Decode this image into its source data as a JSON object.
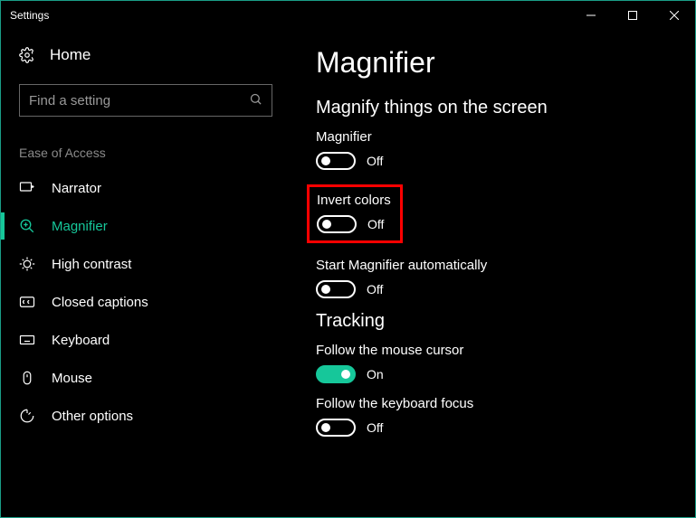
{
  "window": {
    "title": "Settings"
  },
  "sidebar": {
    "home": "Home",
    "search_placeholder": "Find a setting",
    "section": "Ease of Access",
    "items": [
      {
        "label": "Narrator"
      },
      {
        "label": "Magnifier"
      },
      {
        "label": "High contrast"
      },
      {
        "label": "Closed captions"
      },
      {
        "label": "Keyboard"
      },
      {
        "label": "Mouse"
      },
      {
        "label": "Other options"
      }
    ]
  },
  "page": {
    "title": "Magnifier",
    "section1": "Magnify things on the screen",
    "magnifier": {
      "label": "Magnifier",
      "state": "Off",
      "on": false
    },
    "invert": {
      "label": "Invert colors",
      "state": "Off",
      "on": false
    },
    "autostart": {
      "label": "Start Magnifier automatically",
      "state": "Off",
      "on": false
    },
    "section2": "Tracking",
    "follow_mouse": {
      "label": "Follow the mouse cursor",
      "state": "On",
      "on": true
    },
    "follow_keyboard": {
      "label": "Follow the keyboard focus",
      "state": "Off",
      "on": false
    }
  },
  "colors": {
    "accent": "#16c79a",
    "highlight": "#ff0000"
  }
}
